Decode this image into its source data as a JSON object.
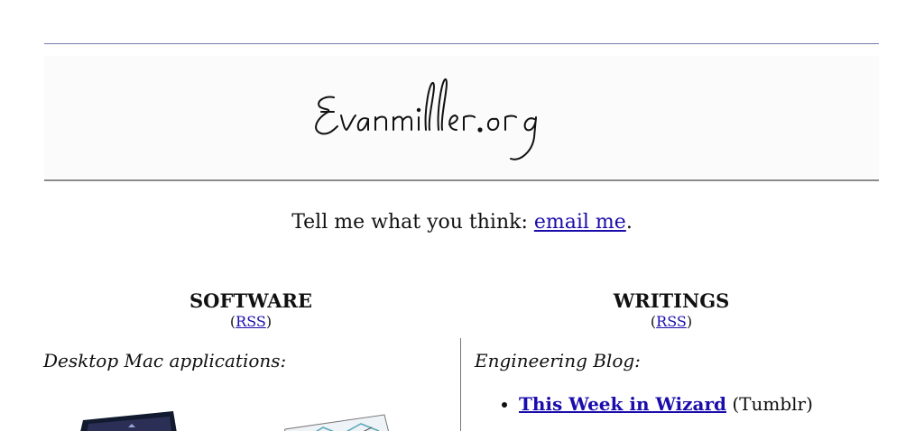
{
  "header": {
    "logo_text": "Evanmiller.org"
  },
  "contact": {
    "prefix": "Tell me what you think: ",
    "link_text": "email me",
    "suffix": "."
  },
  "software": {
    "title": "SOFTWARE",
    "rss_open": "(",
    "rss_label": "RSS",
    "rss_close": ")",
    "section_label": "Desktop Mac applications:"
  },
  "writings": {
    "title": "WRITINGS",
    "rss_open": "(",
    "rss_label": "RSS",
    "rss_close": ")",
    "section_label": "Engineering Blog:",
    "items": [
      {
        "link": "This Week in Wizard",
        "note": " (Tumblr)"
      }
    ]
  },
  "colors": {
    "link": "#1a0dab",
    "rule_top": "#6f7ba8",
    "rule_bottom": "#8a8a8a"
  }
}
